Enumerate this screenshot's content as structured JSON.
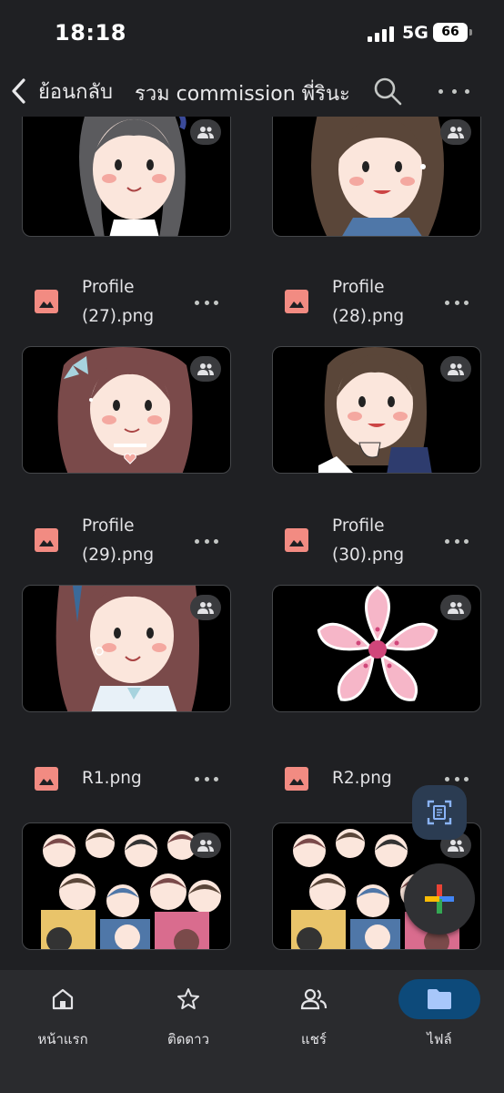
{
  "status_bar": {
    "time": "18:18",
    "network": "5G",
    "battery": "66"
  },
  "header": {
    "back_label": "ย้อนกลับ",
    "folder_title": "รวม commission พี่รินะ"
  },
  "files": [
    {
      "name": "Profile (27).png",
      "shared": true
    },
    {
      "name": "Profile (28).png",
      "shared": true
    },
    {
      "name": "Profile (29).png",
      "shared": true
    },
    {
      "name": "Profile (30).png",
      "shared": true
    },
    {
      "name": "R1.png",
      "shared": true
    },
    {
      "name": "R2.png",
      "shared": true
    }
  ],
  "bottom_nav": [
    {
      "label": "หน้าแรก",
      "icon": "home-icon",
      "active": false
    },
    {
      "label": "ติดดาว",
      "icon": "star-icon",
      "active": false
    },
    {
      "label": "แชร์",
      "icon": "people-icon",
      "active": false
    },
    {
      "label": "ไฟล์",
      "icon": "folder-icon",
      "active": true
    }
  ],
  "colors": {
    "file_icon": "#f28b82",
    "active_nav": "#0d4a7a",
    "scan_fab_bg": "#2b3c52",
    "scan_fab_icon": "#8ab4f8",
    "background": "#1f2023"
  }
}
